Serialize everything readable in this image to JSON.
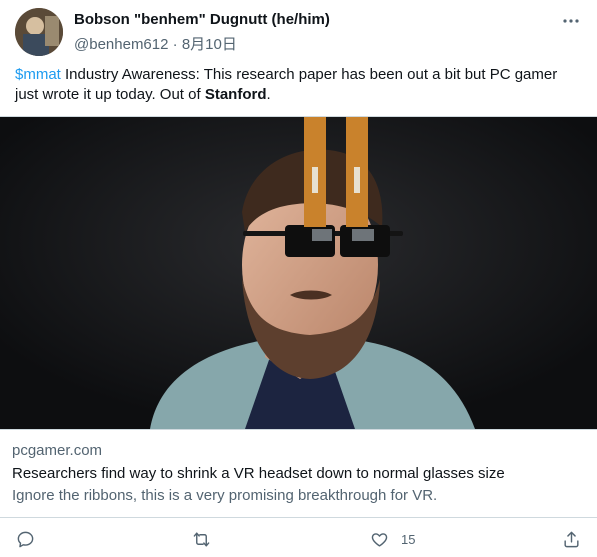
{
  "author": {
    "display_name": "Bobson \"benhem\" Dugnutt (he/him)",
    "handle": "@benhem612",
    "separator": " · ",
    "date": "8月10日"
  },
  "tweet": {
    "cashtag": "$mmat",
    "text_part1": " Industry Awareness: This research paper has been out a bit but PC gamer just wrote it up today. Out of ",
    "bold_word": "Stanford",
    "text_end": "."
  },
  "card": {
    "domain": "pcgamer.com",
    "title": "Researchers find way to shrink a VR headset down to normal glasses size",
    "description": "Ignore the ribbons, this is a very promising breakthrough for VR."
  },
  "actions": {
    "reply_count": "",
    "retweet_count": "",
    "like_count": "15",
    "share_count": ""
  },
  "icons": {
    "more": "more-horizontal-icon",
    "reply": "reply-icon",
    "retweet": "retweet-icon",
    "like": "heart-icon",
    "share": "share-icon"
  },
  "colors": {
    "link": "#1d9bf0",
    "secondary_text": "#536471",
    "primary_text": "#0f1419",
    "border": "#cfd9de"
  }
}
